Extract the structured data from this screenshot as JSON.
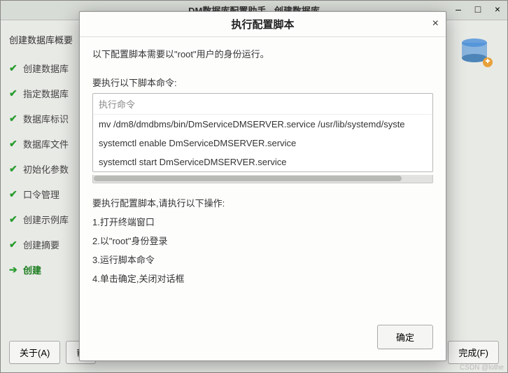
{
  "parent_window": {
    "title": "DM数据库配置助手 - 创建数据库"
  },
  "sidebar": {
    "title": "创建数据库概要",
    "steps": [
      {
        "label": "创建数据库",
        "done": true
      },
      {
        "label": "指定数据库",
        "done": true
      },
      {
        "label": "数据库标识",
        "done": true
      },
      {
        "label": "数据库文件",
        "done": true
      },
      {
        "label": "初始化参数",
        "done": true
      },
      {
        "label": "口令管理",
        "done": true
      },
      {
        "label": "创建示例库",
        "done": true
      },
      {
        "label": "创建摘要",
        "done": true
      },
      {
        "label": "创建",
        "done": false,
        "active": true
      }
    ]
  },
  "footer": {
    "about": "关于(A)",
    "help": "帮",
    "finish": "完成(F)"
  },
  "modal": {
    "title": "执行配置脚本",
    "intro": "以下配置脚本需要以\"root\"用户的身份运行。",
    "commands_label": "要执行以下脚本命令:",
    "commands_header": "执行命令",
    "commands": [
      "mv /dm8/dmdbms/bin/DmServiceDMSERVER.service /usr/lib/systemd/syste",
      "systemctl enable DmServiceDMSERVER.service",
      "systemctl start DmServiceDMSERVER.service"
    ],
    "instructions_label": "要执行配置脚本,请执行以下操作:",
    "instructions": [
      "1.打开终端窗口",
      "2.以\"root\"身份登录",
      "3.运行脚本命令",
      "4.单击确定,关闭对话框"
    ],
    "ok_button": "确定"
  },
  "watermark": "CSDN @lothe"
}
